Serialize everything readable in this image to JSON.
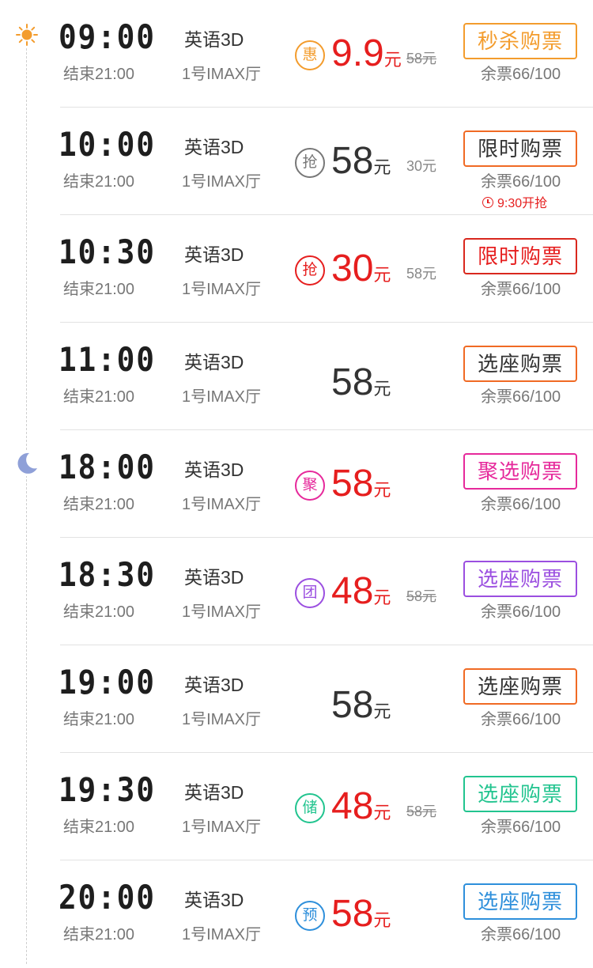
{
  "periods": {
    "morning_icon": "sun-icon",
    "evening_icon": "moon-icon"
  },
  "colors": {
    "price_red": "#e61e1e",
    "default_button_border": "#f06a24",
    "timeline": "#cfcfcf"
  },
  "showtimes": [
    {
      "start": "09:00",
      "end": "结束21:00",
      "language": "英语3D",
      "hall": "1号IMAX厅",
      "badge": "惠",
      "badge_color": "#f39c2d",
      "price": "9.9",
      "unit": "元",
      "price_style": "promo",
      "original_price": "58元",
      "original_strike": true,
      "button": "秒杀购票",
      "button_color": "#f39c2d",
      "button_text_color": "#f39c2d",
      "remaining": "余票66/100",
      "countdown": ""
    },
    {
      "start": "10:00",
      "end": "结束21:00",
      "language": "英语3D",
      "hall": "1号IMAX厅",
      "badge": "抢",
      "badge_color": "#777777",
      "price": "58",
      "unit": "元",
      "price_style": "plain",
      "original_price": "30元",
      "original_strike": false,
      "button": "限时购票",
      "button_color": "#f06a24",
      "button_text_color": "#333333",
      "remaining": "余票66/100",
      "countdown": "9:30开抢"
    },
    {
      "start": "10:30",
      "end": "结束21:00",
      "language": "英语3D",
      "hall": "1号IMAX厅",
      "badge": "抢",
      "badge_color": "#e61e1e",
      "price": "30",
      "unit": "元",
      "price_style": "promo",
      "original_price": "58元",
      "original_strike": false,
      "button": "限时购票",
      "button_color": "#d9281e",
      "button_text_color": "#e61e1e",
      "remaining": "余票66/100",
      "countdown": ""
    },
    {
      "start": "11:00",
      "end": "结束21:00",
      "language": "英语3D",
      "hall": "1号IMAX厅",
      "badge": "",
      "badge_color": "",
      "price": "58",
      "unit": "元",
      "price_style": "plain",
      "original_price": "",
      "original_strike": false,
      "button": "选座购票",
      "button_color": "#f06a24",
      "button_text_color": "#333333",
      "remaining": "余票66/100",
      "countdown": ""
    },
    {
      "start": "18:00",
      "end": "结束21:00",
      "language": "英语3D",
      "hall": "1号IMAX厅",
      "badge": "聚",
      "badge_color": "#e6299b",
      "price": "58",
      "unit": "元",
      "price_style": "promo",
      "original_price": "",
      "original_strike": false,
      "button": "聚选购票",
      "button_color": "#e6299b",
      "button_text_color": "#e6299b",
      "remaining": "余票66/100",
      "countdown": ""
    },
    {
      "start": "18:30",
      "end": "结束21:00",
      "language": "英语3D",
      "hall": "1号IMAX厅",
      "badge": "团",
      "badge_color": "#9b4fe0",
      "price": "48",
      "unit": "元",
      "price_style": "promo",
      "original_price": "58元",
      "original_strike": true,
      "button": "选座购票",
      "button_color": "#9b4fe0",
      "button_text_color": "#9b4fe0",
      "remaining": "余票66/100",
      "countdown": ""
    },
    {
      "start": "19:00",
      "end": "结束21:00",
      "language": "英语3D",
      "hall": "1号IMAX厅",
      "badge": "",
      "badge_color": "",
      "price": "58",
      "unit": "元",
      "price_style": "plain",
      "original_price": "",
      "original_strike": false,
      "button": "选座购票",
      "button_color": "#f06a24",
      "button_text_color": "#333333",
      "remaining": "余票66/100",
      "countdown": ""
    },
    {
      "start": "19:30",
      "end": "结束21:00",
      "language": "英语3D",
      "hall": "1号IMAX厅",
      "badge": "储",
      "badge_color": "#22c48f",
      "price": "48",
      "unit": "元",
      "price_style": "promo",
      "original_price": "58元",
      "original_strike": true,
      "button": "选座购票",
      "button_color": "#22c48f",
      "button_text_color": "#22c48f",
      "remaining": "余票66/100",
      "countdown": ""
    },
    {
      "start": "20:00",
      "end": "结束21:00",
      "language": "英语3D",
      "hall": "1号IMAX厅",
      "badge": "预",
      "badge_color": "#2e8fdb",
      "price": "58",
      "unit": "元",
      "price_style": "promo",
      "original_price": "",
      "original_strike": false,
      "button": "选座购票",
      "button_color": "#2e8fdb",
      "button_text_color": "#2e8fdb",
      "remaining": "余票66/100",
      "countdown": ""
    }
  ]
}
